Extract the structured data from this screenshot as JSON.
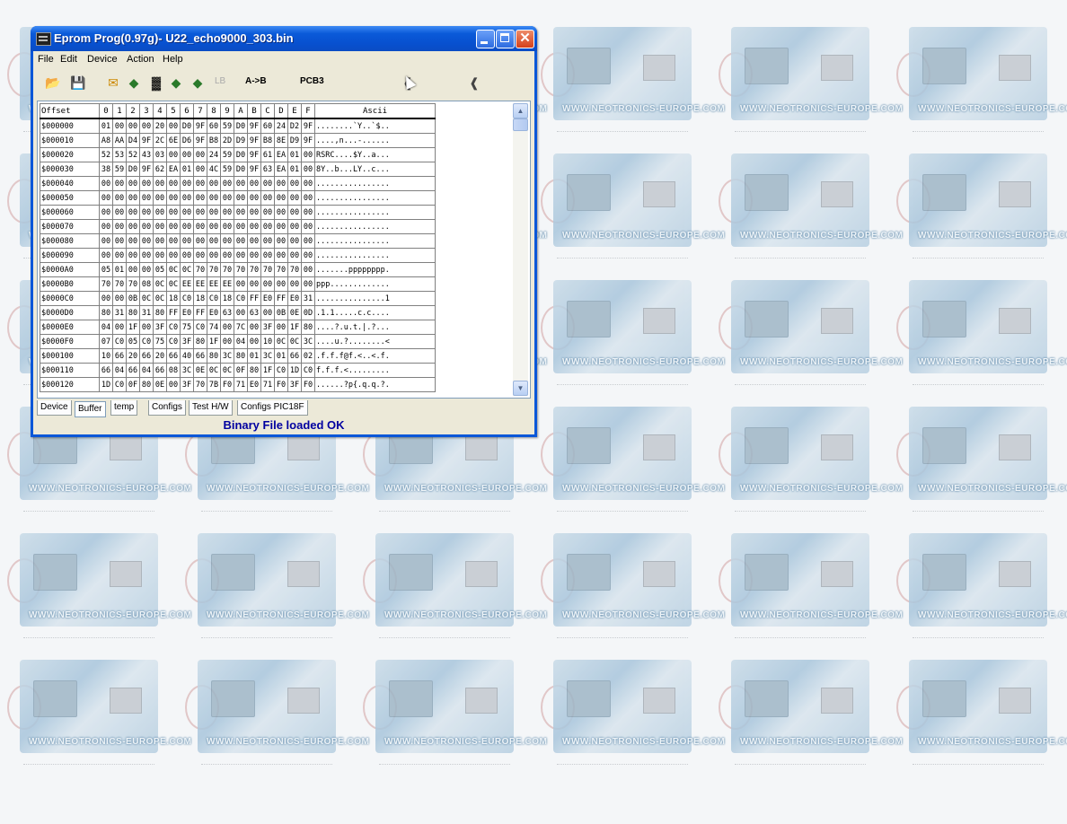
{
  "window": {
    "title": "Eprom Prog(0.97g)- U22_echo9000_303.bin"
  },
  "menu": [
    "File",
    "Edit",
    "Device",
    "Action",
    "Help"
  ],
  "toolbar": {
    "icons": [
      "open-icon",
      "save-icon",
      "read-icon",
      "program-icon",
      "erase-icon",
      "verify-icon",
      "blank-check-icon"
    ],
    "lb_label": "LB",
    "ab_label": "A->B",
    "pcb_label": "PCB3",
    "active_icon": "chip-arrow-icon",
    "second_icon": "chip-arrow-icon"
  },
  "hex_view": {
    "headers": [
      "Offset",
      "0",
      "1",
      "2",
      "3",
      "4",
      "5",
      "6",
      "7",
      "8",
      "9",
      "A",
      "B",
      "C",
      "D",
      "E",
      "F",
      "Ascii"
    ],
    "rows": [
      {
        "offset": "$000000",
        "bytes": [
          "01",
          "00",
          "00",
          "00",
          "20",
          "00",
          "D0",
          "9F",
          "60",
          "59",
          "D0",
          "9F",
          "60",
          "24",
          "D2",
          "9F"
        ],
        "ascii": "........`Y..`$.."
      },
      {
        "offset": "$000010",
        "bytes": [
          "A8",
          "AA",
          "D4",
          "9F",
          "2C",
          "6E",
          "D6",
          "9F",
          "B8",
          "2D",
          "D9",
          "9F",
          "B8",
          "8E",
          "D9",
          "9F"
        ],
        "ascii": "....,n...-......"
      },
      {
        "offset": "$000020",
        "bytes": [
          "52",
          "53",
          "52",
          "43",
          "03",
          "00",
          "00",
          "00",
          "24",
          "59",
          "D0",
          "9F",
          "61",
          "EA",
          "01",
          "00"
        ],
        "ascii": "RSRC....$Y..a..."
      },
      {
        "offset": "$000030",
        "bytes": [
          "38",
          "59",
          "D0",
          "9F",
          "62",
          "EA",
          "01",
          "00",
          "4C",
          "59",
          "D0",
          "9F",
          "63",
          "EA",
          "01",
          "00"
        ],
        "ascii": "8Y..b...LY..c..."
      },
      {
        "offset": "$000040",
        "bytes": [
          "00",
          "00",
          "00",
          "00",
          "00",
          "00",
          "00",
          "00",
          "00",
          "00",
          "00",
          "00",
          "00",
          "00",
          "00",
          "00"
        ],
        "ascii": "................"
      },
      {
        "offset": "$000050",
        "bytes": [
          "00",
          "00",
          "00",
          "00",
          "00",
          "00",
          "00",
          "00",
          "00",
          "00",
          "00",
          "00",
          "00",
          "00",
          "00",
          "00"
        ],
        "ascii": "................"
      },
      {
        "offset": "$000060",
        "bytes": [
          "00",
          "00",
          "00",
          "00",
          "00",
          "00",
          "00",
          "00",
          "00",
          "00",
          "00",
          "00",
          "00",
          "00",
          "00",
          "00"
        ],
        "ascii": "................"
      },
      {
        "offset": "$000070",
        "bytes": [
          "00",
          "00",
          "00",
          "00",
          "00",
          "00",
          "00",
          "00",
          "00",
          "00",
          "00",
          "00",
          "00",
          "00",
          "00",
          "00"
        ],
        "ascii": "................"
      },
      {
        "offset": "$000080",
        "bytes": [
          "00",
          "00",
          "00",
          "00",
          "00",
          "00",
          "00",
          "00",
          "00",
          "00",
          "00",
          "00",
          "00",
          "00",
          "00",
          "00"
        ],
        "ascii": "................"
      },
      {
        "offset": "$000090",
        "bytes": [
          "00",
          "00",
          "00",
          "00",
          "00",
          "00",
          "00",
          "00",
          "00",
          "00",
          "00",
          "00",
          "00",
          "00",
          "00",
          "00"
        ],
        "ascii": "................"
      },
      {
        "offset": "$0000A0",
        "bytes": [
          "05",
          "01",
          "00",
          "00",
          "05",
          "0C",
          "0C",
          "70",
          "70",
          "70",
          "70",
          "70",
          "70",
          "70",
          "70",
          "00"
        ],
        "ascii": ".......pppppppp."
      },
      {
        "offset": "$0000B0",
        "bytes": [
          "70",
          "70",
          "70",
          "08",
          "0C",
          "0C",
          "EE",
          "EE",
          "EE",
          "EE",
          "00",
          "00",
          "00",
          "00",
          "00",
          "00"
        ],
        "ascii": "ppp............."
      },
      {
        "offset": "$0000C0",
        "bytes": [
          "00",
          "00",
          "0B",
          "0C",
          "0C",
          "18",
          "C0",
          "18",
          "C0",
          "18",
          "C0",
          "FF",
          "E0",
          "FF",
          "E0",
          "31"
        ],
        "ascii": "...............1"
      },
      {
        "offset": "$0000D0",
        "bytes": [
          "80",
          "31",
          "80",
          "31",
          "80",
          "FF",
          "E0",
          "FF",
          "E0",
          "63",
          "00",
          "63",
          "00",
          "0B",
          "0E",
          "0D"
        ],
        "ascii": ".1.1.....c.c...."
      },
      {
        "offset": "$0000E0",
        "bytes": [
          "04",
          "00",
          "1F",
          "00",
          "3F",
          "C0",
          "75",
          "C0",
          "74",
          "00",
          "7C",
          "00",
          "3F",
          "00",
          "1F",
          "80"
        ],
        "ascii": "....?.u.t.|.?..."
      },
      {
        "offset": "$0000F0",
        "bytes": [
          "07",
          "C0",
          "05",
          "C0",
          "75",
          "C0",
          "3F",
          "80",
          "1F",
          "00",
          "04",
          "00",
          "10",
          "0C",
          "0C",
          "3C"
        ],
        "ascii": "....u.?........<"
      },
      {
        "offset": "$000100",
        "bytes": [
          "10",
          "66",
          "20",
          "66",
          "20",
          "66",
          "40",
          "66",
          "80",
          "3C",
          "80",
          "01",
          "3C",
          "01",
          "66",
          "02"
        ],
        "ascii": ".f.f.f@f.<..<.f."
      },
      {
        "offset": "$000110",
        "bytes": [
          "66",
          "04",
          "66",
          "04",
          "66",
          "08",
          "3C",
          "0E",
          "0C",
          "0C",
          "0F",
          "80",
          "1F",
          "C0",
          "1D",
          "C0"
        ],
        "ascii": "f.f.f.<........."
      },
      {
        "offset": "$000120",
        "bytes": [
          "1D",
          "C0",
          "0F",
          "80",
          "0E",
          "00",
          "3F",
          "70",
          "7B",
          "F0",
          "71",
          "E0",
          "71",
          "F0",
          "3F",
          "F0"
        ],
        "ascii": "......?p{.q.q.?."
      }
    ]
  },
  "tabs": [
    {
      "label": "Device",
      "active": false
    },
    {
      "label": "Buffer",
      "active": true
    },
    {
      "label": "temp",
      "active": false
    },
    {
      "label": "Configs",
      "active": false
    },
    {
      "label": "Test H/W",
      "active": false
    },
    {
      "label": "Configs PIC18F",
      "active": false
    }
  ],
  "status": "Binary File loaded OK",
  "wallpaper": {
    "watermark": "WWW.NEOTRONICS-EUROPE.COM"
  }
}
